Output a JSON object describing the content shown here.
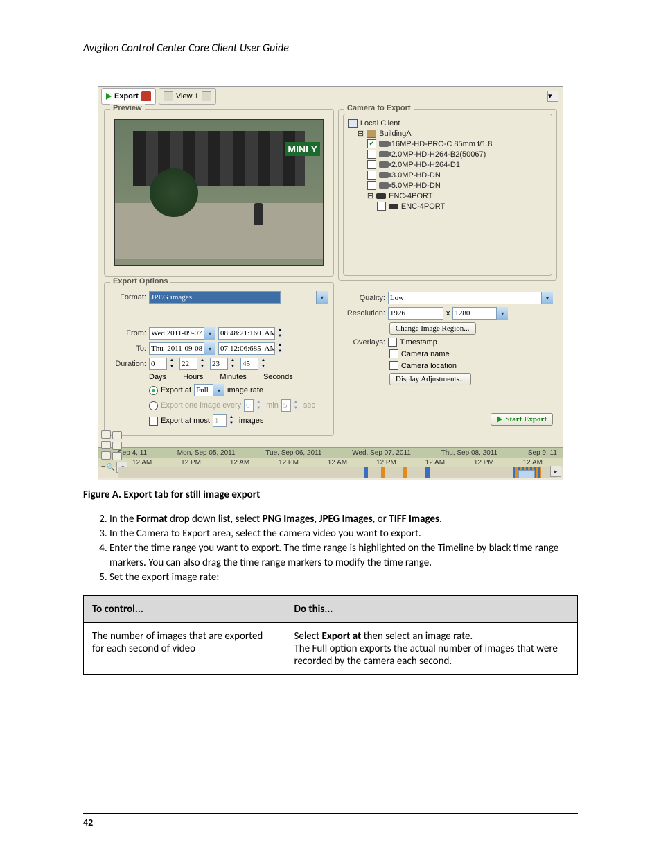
{
  "header": "Avigilon Control Center Core Client User Guide",
  "tabs": {
    "export": "Export",
    "view": "View 1"
  },
  "preview_legend": "Preview",
  "cameras_legend": "Camera to Export",
  "tree": {
    "root": "Local Client",
    "site": "BuildingA",
    "cams": [
      "16MP-HD-PRO-C  85mm f/1.8",
      "2.0MP-HD-H264-B2(50067)",
      "2.0MP-HD-H264-D1",
      "3.0MP-HD-DN",
      "5.0MP-HD-DN"
    ],
    "enc_parent": "ENC-4PORT",
    "enc_child": "ENC-4PORT"
  },
  "export_opts_legend": "Export Options",
  "labels": {
    "format": "Format:",
    "from": "From:",
    "to": "To:",
    "duration": "Duration:",
    "days": "Days",
    "hours": "Hours",
    "minutes": "Minutes",
    "seconds": "Seconds",
    "export_at": "Export at",
    "image_rate": "image rate",
    "export_every": "Export one image every",
    "min": "min",
    "sec": "sec",
    "export_most": "Export at most",
    "images": "images",
    "quality": "Quality:",
    "resolution": "Resolution:",
    "x": "x",
    "overlays": "Overlays:",
    "ov_ts": "Timestamp",
    "ov_name": "Camera name",
    "ov_loc": "Camera location"
  },
  "values": {
    "format": "JPEG images",
    "from_date": "Wed 2011-09-07",
    "from_time": "08:48:21:160  AM",
    "to_date": "Thu  2011-09-08",
    "to_time": "07:12:06:685  AM",
    "d_days": "0",
    "d_hours": "22",
    "d_min": "23",
    "d_sec": "45",
    "rate_sel": "Full",
    "every_min": "0",
    "every_sec": "5",
    "most": "1",
    "quality": "Low",
    "res_w": "1926",
    "res_h": "1280"
  },
  "buttons": {
    "change_region": "Change Image Region...",
    "display_adj": "Display Adjustments...",
    "start_export": "Start Export"
  },
  "timeline": {
    "dates": [
      "Sep 4, 11",
      "Mon, Sep 05, 2011",
      "Tue, Sep 06, 2011",
      "Wed, Sep 07, 2011",
      "Thu, Sep 08, 2011",
      "Sep 9, 11"
    ],
    "hours": [
      "12 AM",
      "12 PM",
      "12 AM",
      "12 PM",
      "12 AM",
      "12 PM",
      "12 AM",
      "12 PM",
      "12 AM"
    ]
  },
  "figure_caption": "Figure A.    Export tab for still image export",
  "steps": [
    "In the Format drop down list, select PNG Images, JPEG Images, or TIFF Images.",
    "In the Camera to Export area, select the camera video you want to export.",
    "Enter the time range you want to export. The time range is highlighted on the Timeline by black time range markers. You can also drag the time range markers to modify the time range.",
    "Set the export image rate:"
  ],
  "table": {
    "h1": "To control...",
    "h2": "Do this...",
    "r1c1": "The number of images that are exported for each second of video",
    "r1c2_a": "Select ",
    "r1c2_b": "Export at",
    "r1c2_c": " then select an image rate.\nThe Full option exports the actual number of images that were recorded by the camera each second."
  },
  "page_number": "42"
}
